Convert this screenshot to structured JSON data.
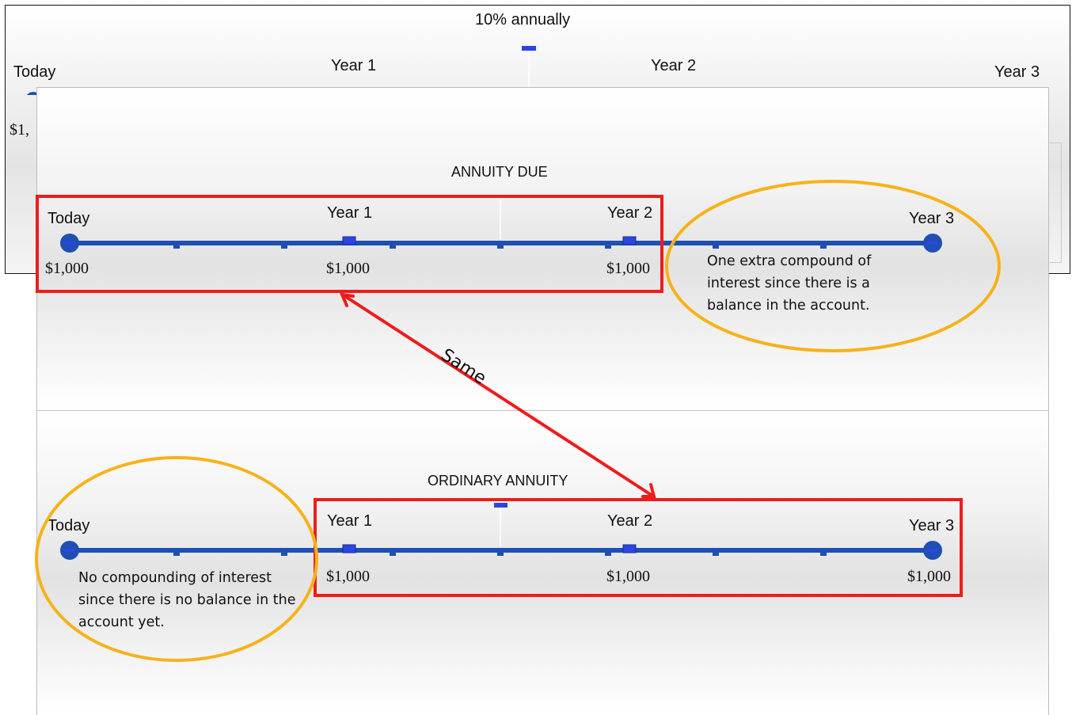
{
  "background": {
    "rate_label": "10% annually",
    "today": "Today",
    "year1": "Year 1",
    "year2": "Year 2",
    "year3": "Year 3",
    "partial_amount": "$1,"
  },
  "annuity_due": {
    "title": "ANNUITY DUE",
    "today": "Today",
    "year1": "Year 1",
    "year2": "Year 2",
    "year3": "Year 3",
    "amount_today": "$1,000",
    "amount_year1": "$1,000",
    "amount_year2": "$1,000",
    "note": "One extra compound of interest since there is a balance in the account."
  },
  "ordinary_annuity": {
    "title": "ORDINARY ANNUITY",
    "today": "Today",
    "year1": "Year 1",
    "year2": "Year 2",
    "year3": "Year 3",
    "amount_year1": "$1,000",
    "amount_year2": "$1,000",
    "amount_year3": "$1,000",
    "note": "No compounding of  interest since there is no balance in the account yet."
  },
  "arrow_label": "Same",
  "colors": {
    "timeline": "#1f4fb4",
    "highlight_box": "#ee1c1c",
    "ellipse": "#f6b21a"
  }
}
